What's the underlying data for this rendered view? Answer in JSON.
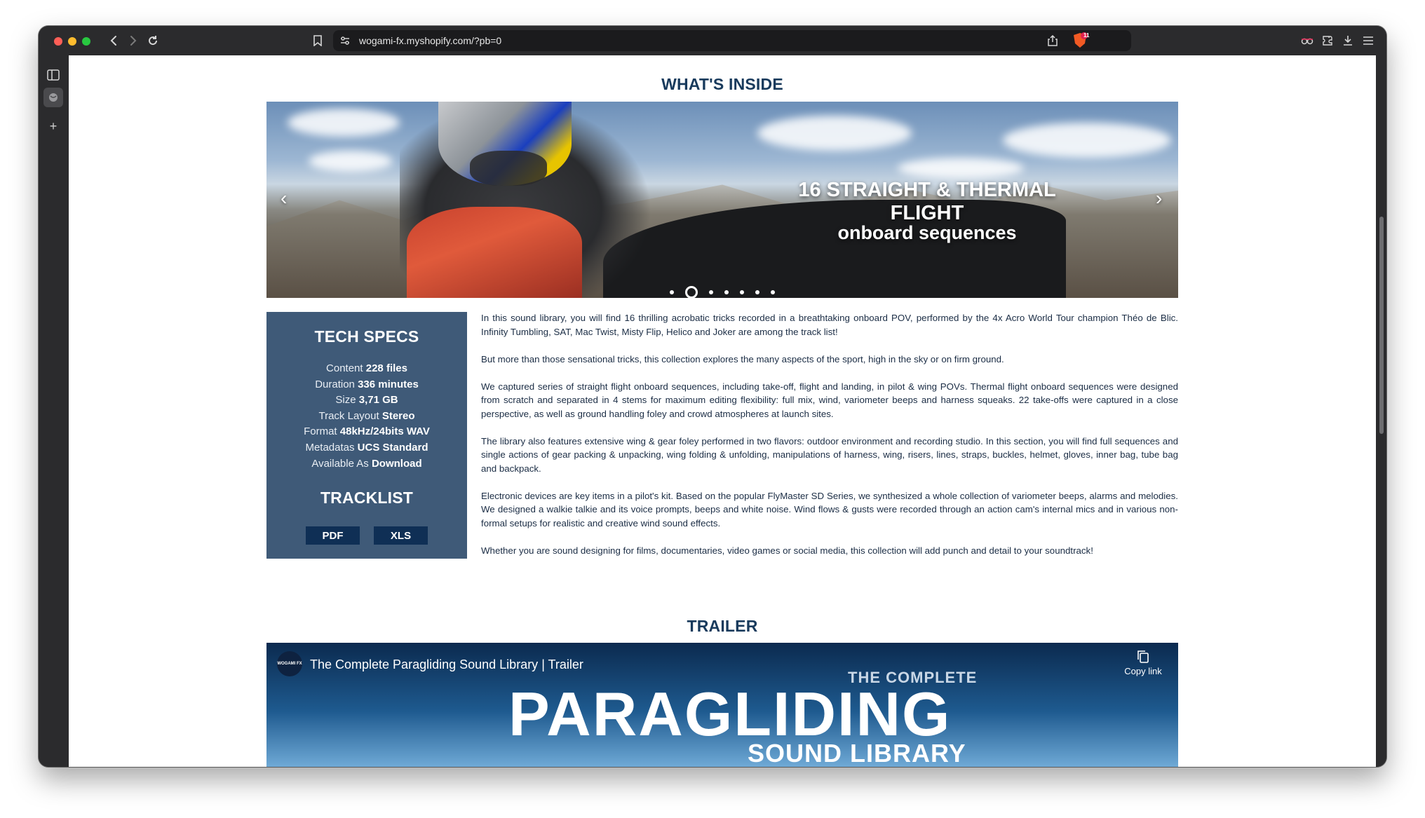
{
  "browser": {
    "url": "wogami-fx.myshopify.com/?pb=0",
    "shield_count": "11"
  },
  "page": {
    "whats_inside_title": "WHAT'S INSIDE",
    "hero": {
      "line1": "16 STRAIGHT & THERMAL FLIGHT",
      "line2": "onboard sequences",
      "slide_count": 7,
      "active_slide": 2
    },
    "specs": {
      "title": "TECH SPECS",
      "rows": [
        {
          "label": "Content",
          "value": "228 files"
        },
        {
          "label": "Duration",
          "value": "336 minutes"
        },
        {
          "label": "Size",
          "value": "3,71 GB"
        },
        {
          "label": "Track Layout",
          "value": "Stereo"
        },
        {
          "label": "Format",
          "value": "48kHz/24bits WAV"
        },
        {
          "label": "Metadatas",
          "value": "UCS Standard"
        },
        {
          "label": "Available As",
          "value": "Download"
        }
      ],
      "tracklist_title": "TRACKLIST",
      "pdf_label": "PDF",
      "xls_label": "XLS"
    },
    "description": [
      "In this sound library, you will find 16 thrilling acrobatic tricks recorded in a breathtaking onboard POV, performed by the 4x Acro World Tour champion Théo de Blic. Infinity Tumbling, SAT, Mac Twist, Misty Flip, Helico and Joker are among the track list!",
      "But more than those sensational tricks, this collection explores the many aspects of the sport, high in the sky or on firm ground.",
      "We captured series of straight flight onboard sequences, including take-off, flight and landing, in pilot & wing POVs. Thermal flight onboard sequences were designed from scratch and separated in 4 stems for maximum editing flexibility: full mix, wind, variometer beeps and harness squeaks. 22 take-offs were captured in a close perspective, as well as ground handling foley and crowd atmospheres at launch sites.",
      "The library also features extensive wing & gear foley performed in two flavors: outdoor environment and recording studio. In this section, you will find full sequences and single actions of gear packing & unpacking, wing folding & unfolding, manipulations of harness, wing, risers, lines, straps, buckles, helmet, gloves, inner bag, tube bag and backpack.",
      "Electronic devices are key items in a pilot's kit. Based on the popular FlyMaster SD Series, we synthesized a whole collection of variometer beeps, alarms and melodies. We designed a walkie talkie and its voice prompts, beeps and white noise. Wind flows & gusts were recorded through an action cam's internal mics and in various non-formal setups for realistic and creative wind sound effects.",
      "Whether you are sound designing for films, documentaries, video games or social media, this collection will add punch and detail to your soundtrack!"
    ],
    "trailer_title": "TRAILER",
    "video": {
      "channel_logo": "WOGAMI FX",
      "title": "The Complete Paragliding Sound Library | Trailer",
      "copy_link": "Copy link",
      "thumb_line1": "THE COMPLETE",
      "thumb_line2": "PARAGLIDING",
      "thumb_line3": "SOUND LIBRARY"
    }
  }
}
